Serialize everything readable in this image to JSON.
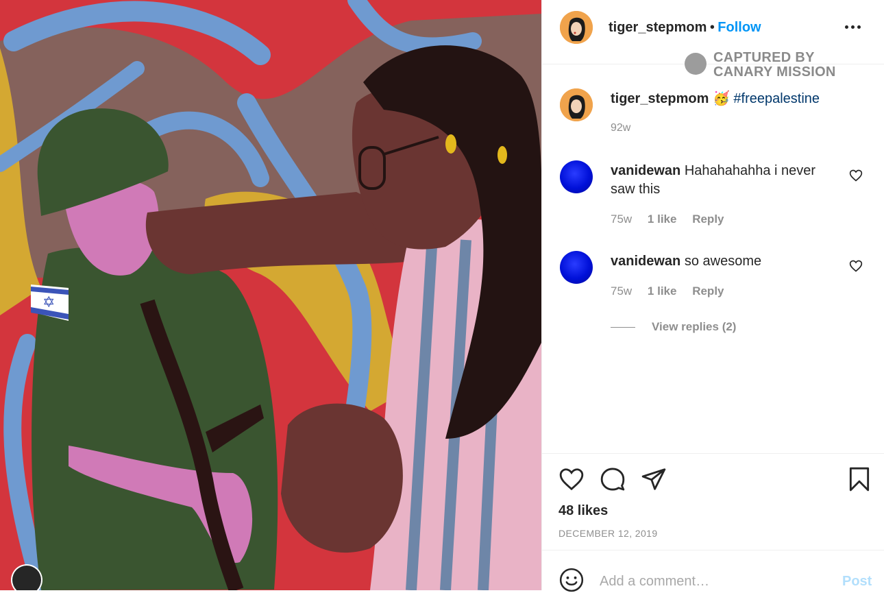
{
  "post": {
    "image_alt": "illustration",
    "owner": "tiger_stepmom",
    "follow_label": "Follow",
    "separator": "•",
    "watermark": [
      "CAPTURED BY",
      "CANARY MISSION"
    ],
    "caption_user": "tiger_stepmom",
    "caption_emoji": "🥳",
    "caption_hashtag": "#freepalestine",
    "caption_time": "92w"
  },
  "comments": [
    {
      "user": "vanidewan",
      "text": "Hahahahahha i never saw this",
      "time": "75w",
      "likes": "1 like",
      "reply": "Reply"
    },
    {
      "user": "vanidewan",
      "text": "so awesome",
      "time": "75w",
      "likes": "1 like",
      "reply": "Reply"
    }
  ],
  "view_replies": "View replies (2)",
  "actions": {
    "likes": "48 likes",
    "date": "DECEMBER 12, 2019"
  },
  "comment_box": {
    "placeholder": "Add a comment…",
    "post_label": "Post"
  },
  "icons": {
    "more": "more-options-icon",
    "like": "heart-icon",
    "comment": "comment-bubble-icon",
    "share": "paper-plane-icon",
    "save": "bookmark-icon",
    "emoji": "smiley-icon"
  },
  "colors": {
    "accent": "#0095f6",
    "hashtag": "#00376b",
    "secondary_text": "#8e8e8e"
  }
}
